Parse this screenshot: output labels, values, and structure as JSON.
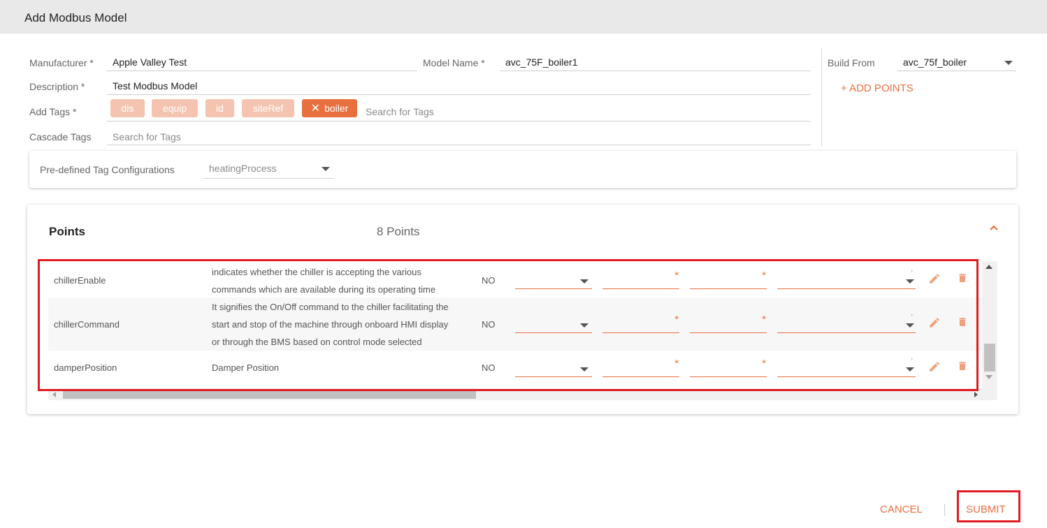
{
  "dialog": {
    "title": "Add Modbus Model"
  },
  "form": {
    "manufacturer": {
      "label": "Manufacturer",
      "required": "*",
      "value": "Apple Valley Test"
    },
    "model_name": {
      "label": "Model Name",
      "required": "*",
      "value": "avc_75F_boiler1"
    },
    "description": {
      "label": "Description",
      "required": "*",
      "value": "Test Modbus Model"
    },
    "add_tags": {
      "label": "Add Tags",
      "required": "*",
      "tags": [
        "dis",
        "equip",
        "id",
        "siteRef"
      ],
      "active_tag": "boiler",
      "placeholder": "Search for Tags"
    },
    "cascade_tags": {
      "label": "Cascade Tags",
      "placeholder": "Search for Tags"
    },
    "build_from": {
      "label": "Build From",
      "value": "avc_75f_boiler"
    },
    "add_points_label": "+ ADD POINTS",
    "predefined": {
      "label": "Pre-defined Tag Configurations",
      "value": "heatingProcess"
    }
  },
  "points": {
    "title": "Points",
    "count_label": "8 Points",
    "rows": [
      {
        "name": "chillerEnable",
        "desc_lines": [
          "indicates whether the chiller is accepting the various",
          "commands which are available during its operating time"
        ],
        "flag": "NO"
      },
      {
        "name": "chillerCommand",
        "desc_lines": [
          "It signifies the On/Off command to the chiller facilitating the",
          "start and stop of the machine through onboard HMI display",
          "or through the BMS based on control mode selected"
        ],
        "flag": "NO"
      },
      {
        "name": "damperPosition",
        "desc_lines": [
          "Damper Position"
        ],
        "flag": "NO"
      }
    ],
    "required_mark": "*",
    "tick_mark": "ʼ"
  },
  "footer": {
    "cancel_label": "CANCEL",
    "submit_label": "SUBMIT"
  },
  "colors": {
    "accent": "#e8703e",
    "chip": "#f5c4b0",
    "highlight": "#e01b22"
  },
  "icons": {
    "collapse": "chevron-up-icon",
    "remove_tag": "close-icon",
    "edit": "pencil-icon",
    "delete": "trash-icon",
    "dropdown": "caret-down-icon"
  }
}
